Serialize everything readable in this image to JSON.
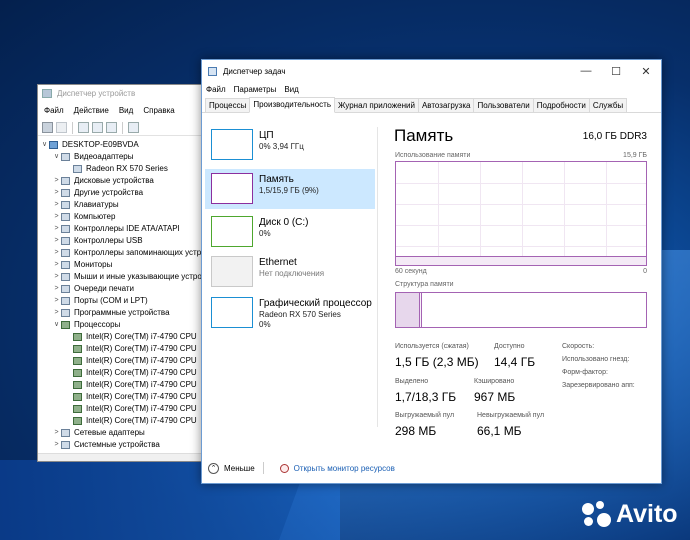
{
  "device_manager": {
    "title": "Диспетчер устройств",
    "menu": [
      "Файл",
      "Действие",
      "Вид",
      "Справка"
    ],
    "tree": [
      {
        "label": "DESKTOP-E09BVDA",
        "level": 0,
        "expander": "∨",
        "icon": "computer-icon"
      },
      {
        "label": "Видеоадаптеры",
        "level": 1,
        "expander": "∨",
        "icon": "display-adapter-icon"
      },
      {
        "label": "Radeon RX 570 Series",
        "level": 2,
        "expander": "",
        "icon": "display-adapter-icon"
      },
      {
        "label": "Дисковые устройства",
        "level": 1,
        "expander": ">",
        "icon": "disk-icon"
      },
      {
        "label": "Другие устройства",
        "level": 1,
        "expander": ">",
        "icon": "unknown-device-icon"
      },
      {
        "label": "Клавиатуры",
        "level": 1,
        "expander": ">",
        "icon": "keyboard-icon"
      },
      {
        "label": "Компьютер",
        "level": 1,
        "expander": ">",
        "icon": "computer-icon"
      },
      {
        "label": "Контроллеры IDE ATA/ATAPI",
        "level": 1,
        "expander": ">",
        "icon": "ide-controller-icon"
      },
      {
        "label": "Контроллеры USB",
        "level": 1,
        "expander": ">",
        "icon": "usb-icon"
      },
      {
        "label": "Контроллеры запоминающих устройств",
        "level": 1,
        "expander": ">",
        "icon": "storage-controller-icon"
      },
      {
        "label": "Мониторы",
        "level": 1,
        "expander": ">",
        "icon": "monitor-icon"
      },
      {
        "label": "Мыши и иные указывающие устройства",
        "level": 1,
        "expander": ">",
        "icon": "mouse-icon"
      },
      {
        "label": "Очереди печати",
        "level": 1,
        "expander": ">",
        "icon": "printer-icon"
      },
      {
        "label": "Порты (COM и LPT)",
        "level": 1,
        "expander": ">",
        "icon": "port-icon"
      },
      {
        "label": "Программные устройства",
        "level": 1,
        "expander": ">",
        "icon": "software-device-icon"
      },
      {
        "label": "Процессоры",
        "level": 1,
        "expander": "∨",
        "icon": "processor-icon"
      },
      {
        "label": "Intel(R) Core(TM) i7-4790 CPU",
        "level": 2,
        "expander": "",
        "icon": "processor-icon"
      },
      {
        "label": "Intel(R) Core(TM) i7-4790 CPU",
        "level": 2,
        "expander": "",
        "icon": "processor-icon"
      },
      {
        "label": "Intel(R) Core(TM) i7-4790 CPU",
        "level": 2,
        "expander": "",
        "icon": "processor-icon"
      },
      {
        "label": "Intel(R) Core(TM) i7-4790 CPU",
        "level": 2,
        "expander": "",
        "icon": "processor-icon"
      },
      {
        "label": "Intel(R) Core(TM) i7-4790 CPU",
        "level": 2,
        "expander": "",
        "icon": "processor-icon"
      },
      {
        "label": "Intel(R) Core(TM) i7-4790 CPU",
        "level": 2,
        "expander": "",
        "icon": "processor-icon"
      },
      {
        "label": "Intel(R) Core(TM) i7-4790 CPU",
        "level": 2,
        "expander": "",
        "icon": "processor-icon"
      },
      {
        "label": "Intel(R) Core(TM) i7-4790 CPU",
        "level": 2,
        "expander": "",
        "icon": "processor-icon"
      },
      {
        "label": "Сетевые адаптеры",
        "level": 1,
        "expander": ">",
        "icon": "network-adapter-icon"
      },
      {
        "label": "Системные устройства",
        "level": 1,
        "expander": ">",
        "icon": "system-device-icon"
      }
    ]
  },
  "task_manager": {
    "title": "Диспетчер задач",
    "window_controls": {
      "minimize": "—",
      "maximize": "☐",
      "close": "✕"
    },
    "menu": [
      "Файл",
      "Параметры",
      "Вид"
    ],
    "tabs": [
      "Процессы",
      "Производительность",
      "Журнал приложений",
      "Автозагрузка",
      "Пользователи",
      "Подробности",
      "Службы"
    ],
    "active_tab": "Производительность",
    "resources": [
      {
        "name": "ЦП",
        "sub1": "0% 3,94 ГГц",
        "sub2": "",
        "kind": "cpu",
        "selected": false
      },
      {
        "name": "Память",
        "sub1": "1,5/15,9 ГБ (9%)",
        "sub2": "",
        "kind": "mem",
        "selected": true
      },
      {
        "name": "Диск 0 (C:)",
        "sub1": "0%",
        "sub2": "",
        "kind": "disk",
        "selected": false
      },
      {
        "name": "Ethernet",
        "sub1": "Нет подключения",
        "sub2": "",
        "kind": "eth",
        "selected": false
      },
      {
        "name": "Графический процессор",
        "sub1": "Radeon RX 570 Series",
        "sub2": "0%",
        "kind": "gpu",
        "selected": false
      }
    ],
    "memory": {
      "title": "Память",
      "spec": "16,0 ГБ DDR3",
      "usage_label": "Использование памяти",
      "usage_max": "15,9 ГБ",
      "time_left": "60 секунд",
      "time_right": "0",
      "usage_fraction": 0.09,
      "composition_label": "Структура памяти",
      "composition": {
        "in_use_fraction": 0.094,
        "modified_fraction": 0.006
      },
      "stats": {
        "in_use_label": "Используется (сжатая)",
        "in_use_value": "1,5 ГБ (2,3 МБ)",
        "available_label": "Доступно",
        "available_value": "14,4 ГБ",
        "committed_label": "Выделено",
        "committed_value": "1,7/18,3 ГБ",
        "cached_label": "Кэшировано",
        "cached_value": "967 МБ",
        "paged_label": "Выгружаемый пул",
        "paged_value": "298 МБ",
        "nonpaged_label": "Невыгружаемый пул",
        "nonpaged_value": "66,1 МБ"
      },
      "side_labels": [
        "Скорость:",
        "Использовано гнезд:",
        "Форм-фактор:",
        "Зарезервировано апп:"
      ]
    },
    "footer": {
      "less": "Меньше",
      "monitor": "Открыть монитор ресурсов",
      "less_icon": "chevron-up-icon"
    }
  },
  "watermark": {
    "brand": "Avito"
  }
}
